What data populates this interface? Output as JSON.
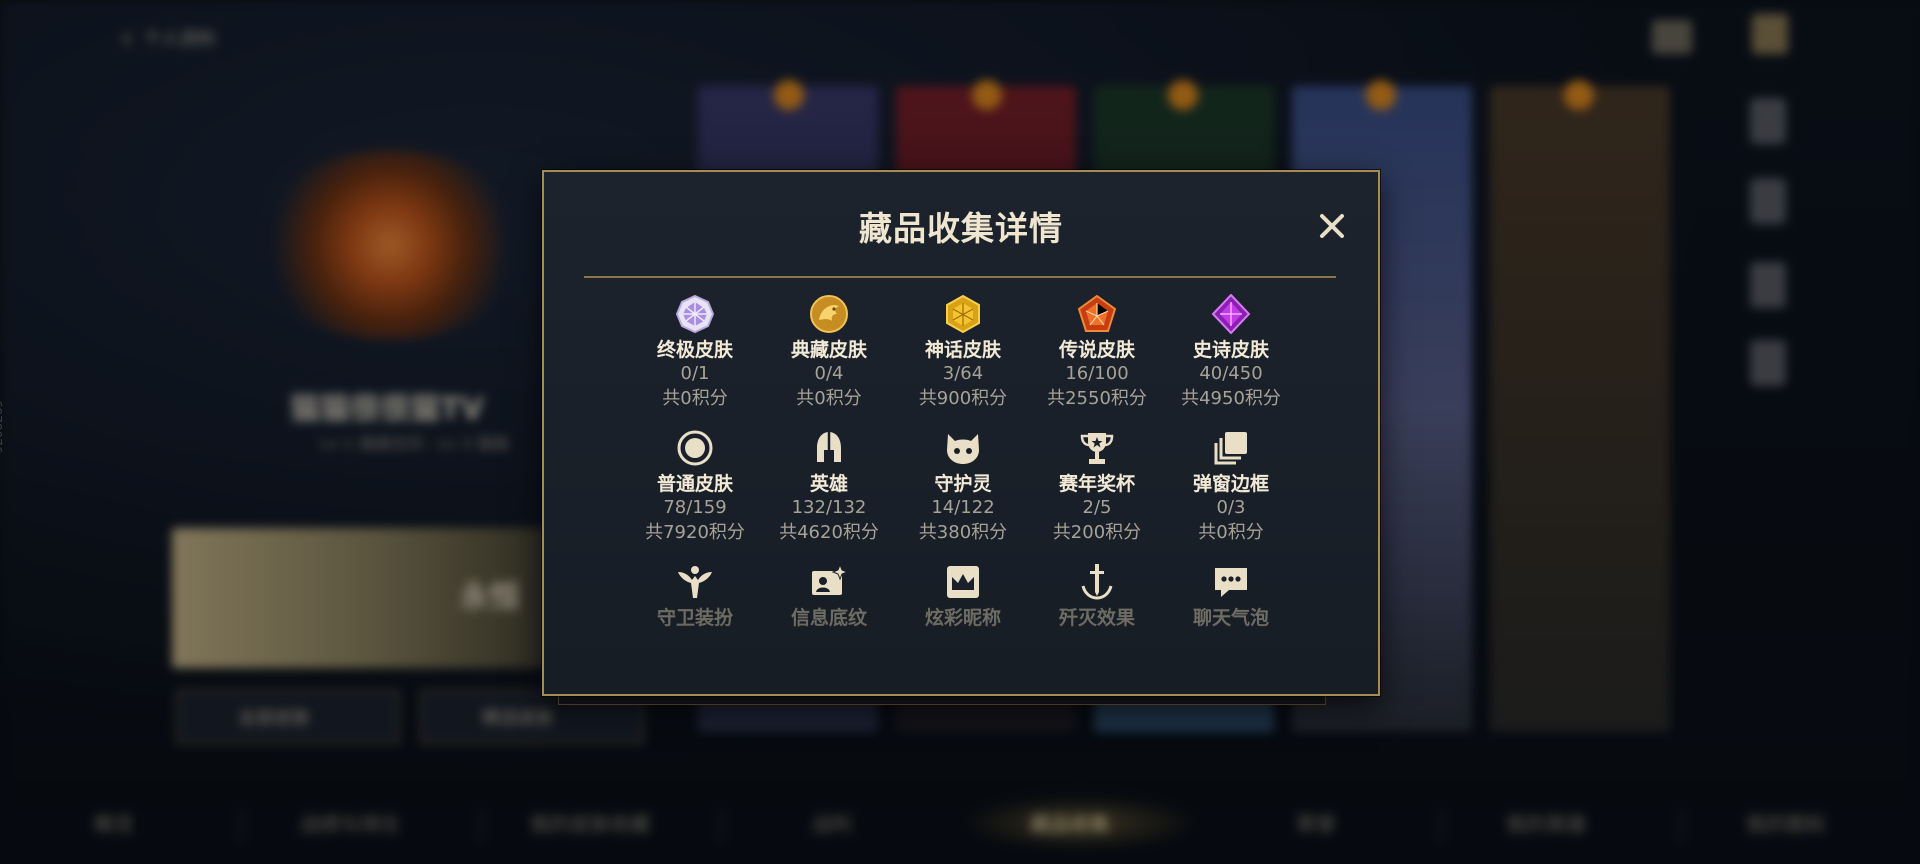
{
  "background": {
    "nav_title": "个人资料",
    "player_name": "猫猫很很猫TV",
    "player_sub": "Lv 1 猫猫空间 · Lv 3 猫猫",
    "banner_text": "永恒",
    "buttons": [
      "全部皮肤",
      "精选皮肤"
    ],
    "side_id": "6978076",
    "bottom_tabs": [
      "概览",
      "战绩与排位",
      "我的皮肤收藏",
      "战利",
      "藏品收集",
      "荣誉",
      "我的英雄",
      "我的图标"
    ],
    "active_tab_index": 4
  },
  "modal": {
    "title": "藏品收集详情",
    "close_icon": "close-icon",
    "rows": [
      [
        {
          "name": "终极皮肤",
          "count": "0/1",
          "points": "共0积分",
          "icon": "ultimate-gem-icon"
        },
        {
          "name": "典藏皮肤",
          "count": "0/4",
          "points": "共0积分",
          "icon": "dragon-medal-icon"
        },
        {
          "name": "神话皮肤",
          "count": "3/64",
          "points": "共900积分",
          "icon": "mythic-gem-icon"
        },
        {
          "name": "传说皮肤",
          "count": "16/100",
          "points": "共2550积分",
          "icon": "legendary-gem-icon"
        },
        {
          "name": "史诗皮肤",
          "count": "40/450",
          "points": "共4950积分",
          "icon": "epic-gem-icon"
        }
      ],
      [
        {
          "name": "普通皮肤",
          "count": "78/159",
          "points": "共7920积分",
          "icon": "ring-icon"
        },
        {
          "name": "英雄",
          "count": "132/132",
          "points": "共4620积分",
          "icon": "helmet-icon"
        },
        {
          "name": "守护灵",
          "count": "14/122",
          "points": "共380积分",
          "icon": "guardian-face-icon"
        },
        {
          "name": "赛年奖杯",
          "count": "2/5",
          "points": "共200积分",
          "icon": "trophy-icon"
        },
        {
          "name": "弹窗边框",
          "count": "0/3",
          "points": "共0积分",
          "icon": "frames-icon"
        }
      ],
      [
        {
          "name": "守卫装扮",
          "icon": "ward-icon"
        },
        {
          "name": "信息底纹",
          "icon": "card-sparkle-icon"
        },
        {
          "name": "炫彩昵称",
          "icon": "crown-card-icon"
        },
        {
          "name": "歼灭效果",
          "icon": "sword-icon"
        },
        {
          "name": "聊天气泡",
          "icon": "chat-bubble-icon"
        }
      ]
    ]
  }
}
